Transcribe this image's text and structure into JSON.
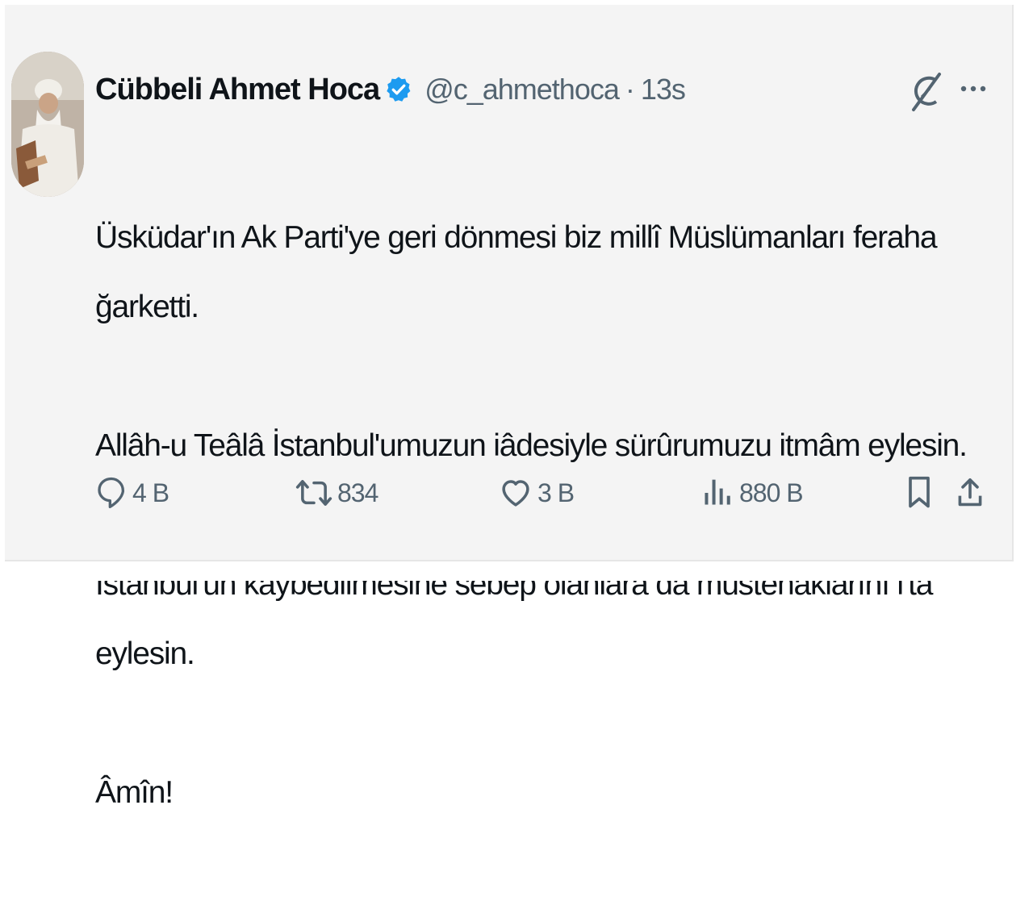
{
  "tweet": {
    "author_name": "Cübbeli Ahmet Hoca",
    "handle": "@c_ahmethoca",
    "separator": "·",
    "time": "13s",
    "text_lines": [
      "Üsküdar'ın Ak Parti'ye geri dönmesi biz millî Müslümanları feraha ğarketti.",
      "Allâh-u Teâlâ İstanbul'umuzun iâdesiyle sürûrumuzu itmâm eylesin.",
      "İstanbul'un kaybedilmesine sebep olanlara da müstehaklarını i'tâ eylesin.",
      "Âmîn!"
    ]
  },
  "actions": {
    "reply_count": "4 B",
    "retweet_count": "834",
    "like_count": "3 B",
    "views_count": "880 B"
  },
  "icons": {
    "verified": "verified-badge-icon",
    "grok": "grok-icon",
    "more": "more-dots-icon",
    "reply": "reply-icon",
    "retweet": "retweet-icon",
    "like": "heart-icon",
    "views": "views-bar-chart-icon",
    "bookmark": "bookmark-icon",
    "share": "share-icon"
  },
  "colors": {
    "text_primary": "#0f1419",
    "text_secondary": "#536471",
    "verified_blue": "#1d9bf0",
    "card_background": "#f4f4f4"
  }
}
